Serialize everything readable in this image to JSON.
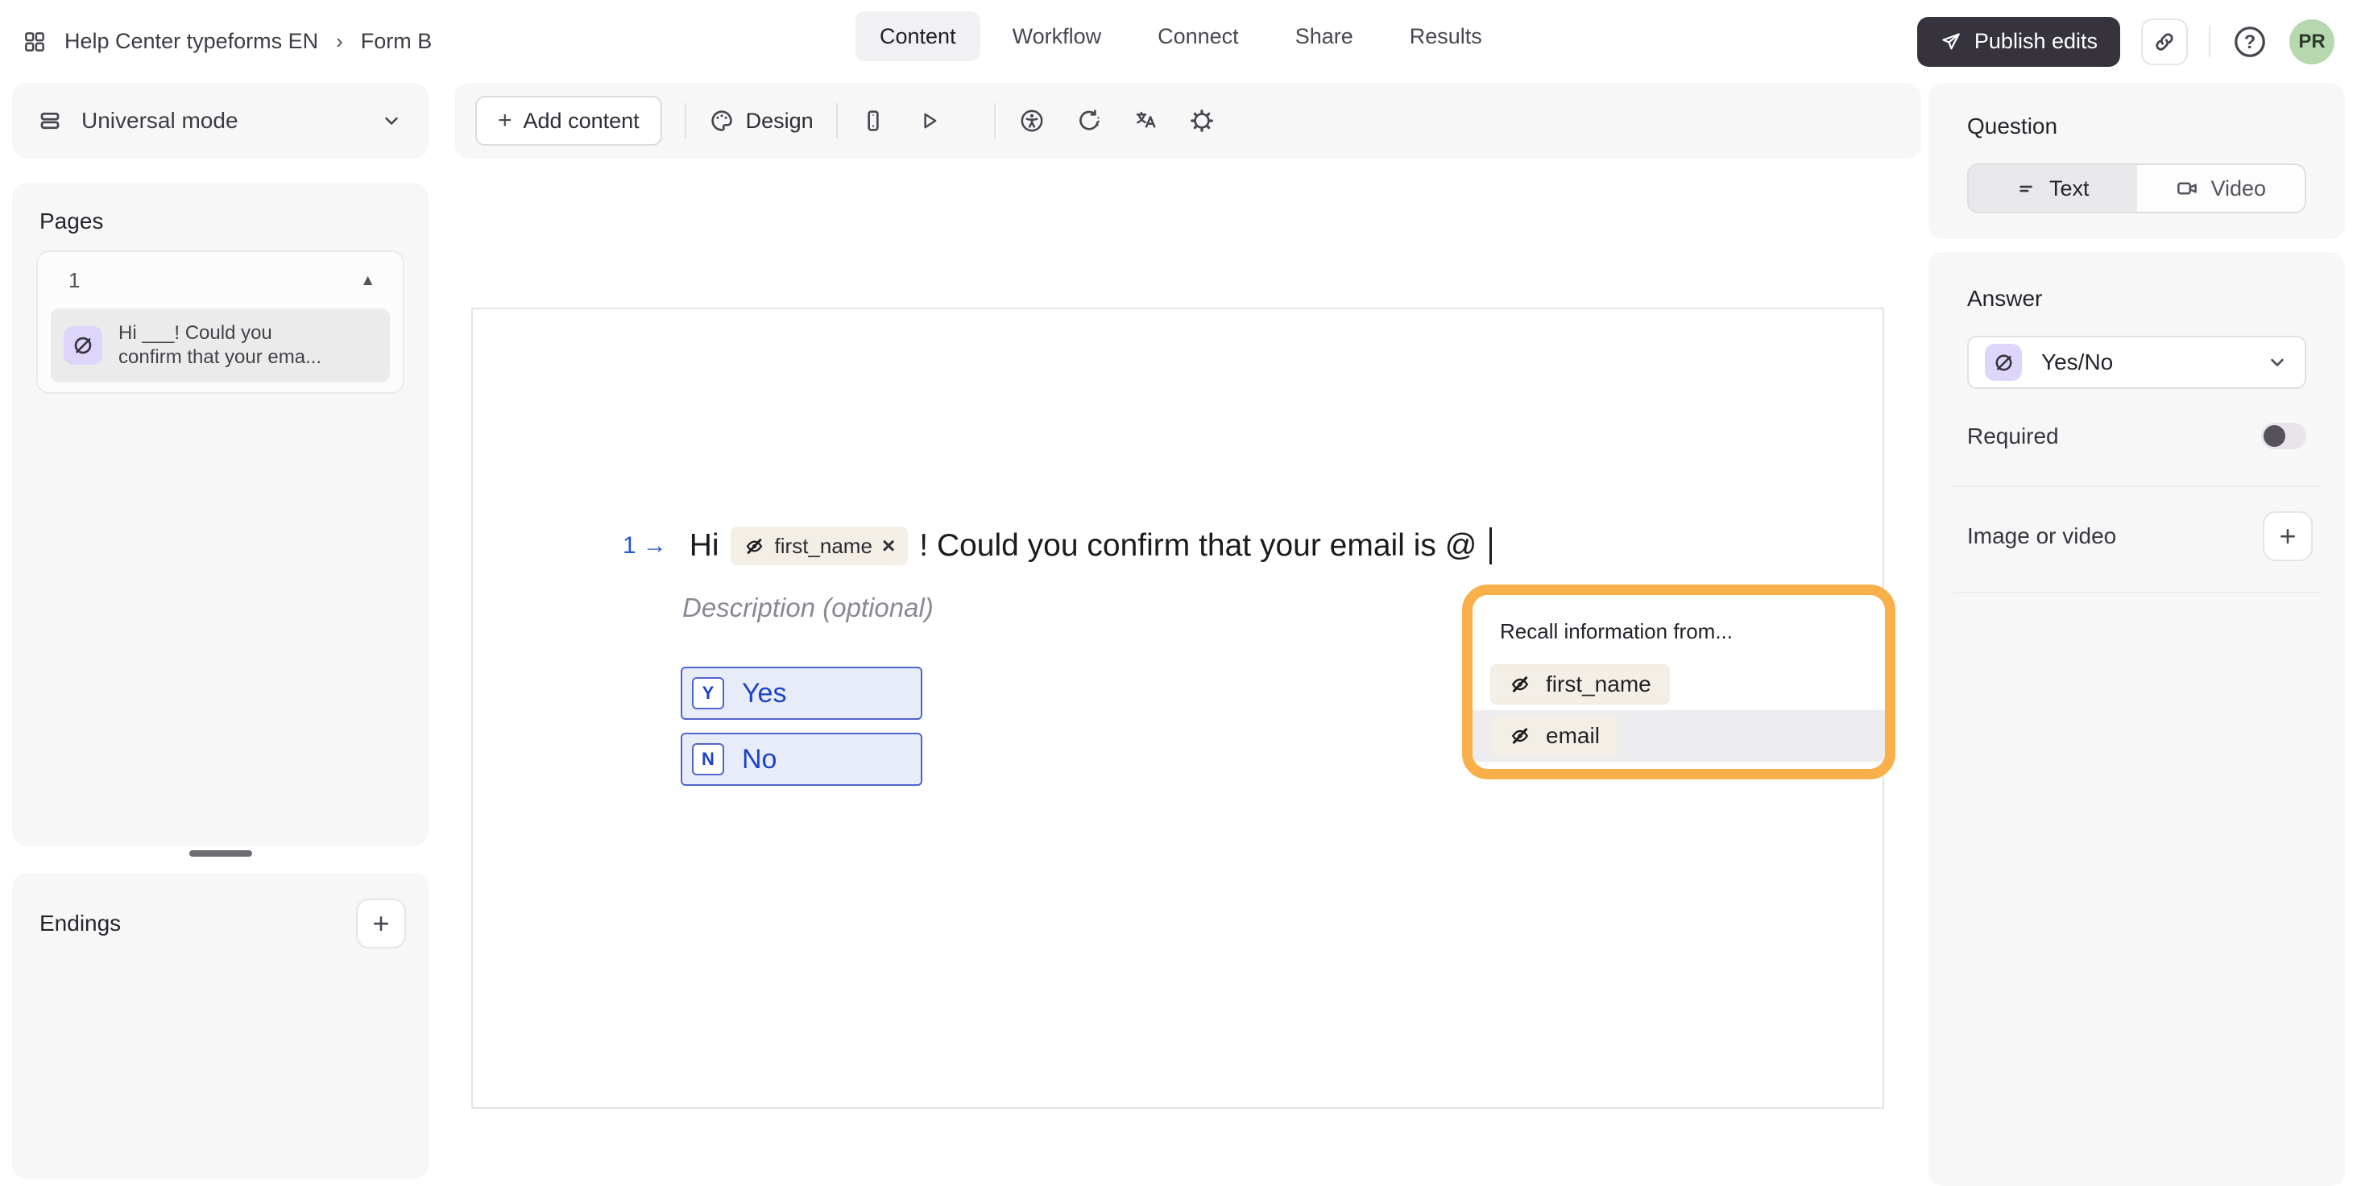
{
  "topbar": {
    "breadcrumb": {
      "workspace": "Help Center typeforms EN",
      "separator": "›",
      "form_name": "Form B"
    },
    "tabs": [
      {
        "label": "Content"
      },
      {
        "label": "Workflow"
      },
      {
        "label": "Connect"
      },
      {
        "label": "Share"
      },
      {
        "label": "Results"
      }
    ],
    "publish_button": "Publish edits",
    "avatar_initials": "PR"
  },
  "sidebar": {
    "mode_selector_label": "Universal mode",
    "pages": {
      "title": "Pages",
      "page_group_number": "1",
      "page_item": {
        "line1": "Hi ___! Could you",
        "line2": "confirm that your ema..."
      }
    },
    "endings": {
      "title": "Endings"
    }
  },
  "toolbar": {
    "add_content_label": "Add content",
    "design_label": "Design"
  },
  "canvas": {
    "question": {
      "number": "1",
      "prefix": "Hi",
      "recall_variable": "first_name",
      "suffix": "! Could you confirm that your email is @"
    },
    "description_placeholder": "Description (optional)",
    "choices": [
      {
        "key": "Y",
        "label": "Yes"
      },
      {
        "key": "N",
        "label": "No"
      }
    ],
    "recall_menu": {
      "title": "Recall information from...",
      "items": [
        {
          "label": "first_name"
        },
        {
          "label": "email"
        }
      ],
      "highlighted_item": "email"
    }
  },
  "right_panel": {
    "question_section": {
      "title": "Question",
      "text_tab": "Text",
      "video_tab": "Video"
    },
    "answer_section": {
      "title": "Answer",
      "selected_type": "Yes/No",
      "required_label": "Required",
      "required_enabled": false,
      "image_or_video_label": "Image or video"
    }
  },
  "icons": {
    "arrow_right": "→",
    "collapse_triangle": "▲",
    "chip_close": "×",
    "plus": "+",
    "question_mark": "?"
  },
  "colors": {
    "accent_blue": "#1d43c8",
    "highlight_orange": "#f9b04a",
    "variable_chip_beige": "#f3efe7",
    "yesno_purple": "#ddd6fa",
    "publish_dark": "#37333d",
    "avatar_green": "#b6d8af",
    "panel_gray": "#f7f7f8"
  }
}
